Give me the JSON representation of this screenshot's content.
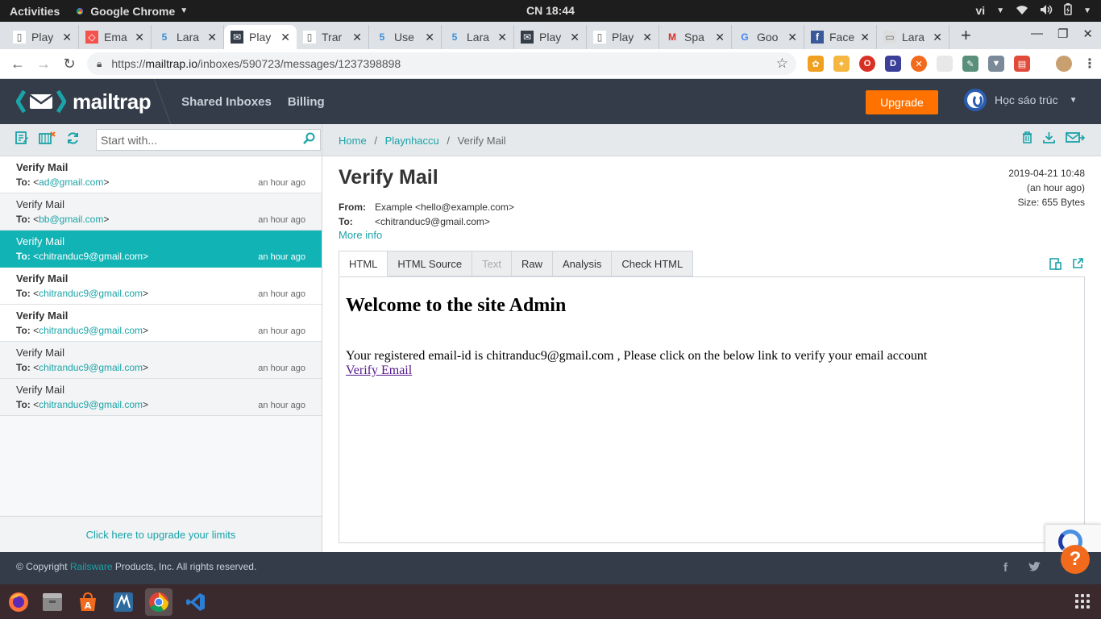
{
  "system": {
    "activities": "Activities",
    "app_name": "Google Chrome",
    "clock": "CN 18:44",
    "lang": "vi"
  },
  "browser": {
    "tabs": [
      {
        "title": "Play",
        "icon": "document-icon"
      },
      {
        "title": "Ema",
        "icon": "laravel-icon"
      },
      {
        "title": "Lara",
        "icon": "laravel-5-icon"
      },
      {
        "title": "Play",
        "icon": "mailtrap-icon",
        "active": true
      },
      {
        "title": "Trar",
        "icon": "document-icon"
      },
      {
        "title": "Use",
        "icon": "laravel-5-icon"
      },
      {
        "title": "Lara",
        "icon": "laravel-5-icon"
      },
      {
        "title": "Play",
        "icon": "mailtrap-icon"
      },
      {
        "title": "Play",
        "icon": "document-icon"
      },
      {
        "title": "Spa",
        "icon": "gmail-icon"
      },
      {
        "title": "Goo",
        "icon": "google-icon"
      },
      {
        "title": "Face",
        "icon": "facebook-icon"
      },
      {
        "title": "Lara",
        "icon": "page-thumbnail-icon"
      }
    ],
    "url_prefix": "https://",
    "url_host": "mailtrap.io",
    "url_path": "/inboxes/590723/messages/1237398898"
  },
  "app": {
    "logo_text": "mailtrap",
    "nav": [
      "Shared Inboxes",
      "Billing"
    ],
    "upgrade_label": "Upgrade",
    "user_name": "Học sáo trúc"
  },
  "sidebar": {
    "search_placeholder": "Start with...",
    "messages": [
      {
        "subject": "Verify Mail",
        "to_label": "To:",
        "to_addr": "ad@gmail.com",
        "time": "an hour ago",
        "state": "unread"
      },
      {
        "subject": "Verify Mail",
        "to_label": "To:",
        "to_addr": "bb@gmail.com",
        "time": "an hour ago",
        "state": "read"
      },
      {
        "subject": "Verify Mail",
        "to_label": "To:",
        "to_addr": "chitranduc9@gmail.com",
        "time": "an hour ago",
        "state": "active"
      },
      {
        "subject": "Verify Mail",
        "to_label": "To:",
        "to_addr": "chitranduc9@gmail.com",
        "time": "an hour ago",
        "state": "unread"
      },
      {
        "subject": "Verify Mail",
        "to_label": "To:",
        "to_addr": "chitranduc9@gmail.com",
        "time": "an hour ago",
        "state": "unread"
      },
      {
        "subject": "Verify Mail",
        "to_label": "To:",
        "to_addr": "chitranduc9@gmail.com",
        "time": "an hour ago",
        "state": "read"
      },
      {
        "subject": "Verify Mail",
        "to_label": "To:",
        "to_addr": "chitranduc9@gmail.com",
        "time": "an hour ago",
        "state": "read"
      }
    ],
    "upgrade_limits": "Click here to upgrade your limits"
  },
  "breadcrumb": [
    "Home",
    "Playnhaccu",
    "Verify Mail"
  ],
  "message": {
    "title": "Verify Mail",
    "date": "2019-04-21 10:48",
    "relative": "(an hour ago)",
    "size": "Size: 655 Bytes",
    "from_label": "From:",
    "from_value": "Example <hello@example.com>",
    "to_label": "To:",
    "to_value": "<chitranduc9@gmail.com>",
    "more_info": "More info",
    "tabs": [
      {
        "label": "HTML",
        "state": "active"
      },
      {
        "label": "HTML Source",
        "state": "normal"
      },
      {
        "label": "Text",
        "state": "disabled"
      },
      {
        "label": "Raw",
        "state": "normal"
      },
      {
        "label": "Analysis",
        "state": "normal"
      },
      {
        "label": "Check HTML",
        "state": "normal"
      }
    ],
    "body_heading": "Welcome to the site Admin",
    "body_text": "Your registered email-id is chitranduc9@gmail.com , Please click on the below link to verify your email account",
    "body_link": "Verify Email"
  },
  "footer": {
    "copy_prefix": "© Copyright ",
    "copy_link": "Railsware",
    "copy_suffix": " Products, Inc. All rights reserved."
  },
  "colors": {
    "accent": "#12b3b5",
    "header_bg": "#333c48",
    "upgrade": "#ff7200"
  }
}
